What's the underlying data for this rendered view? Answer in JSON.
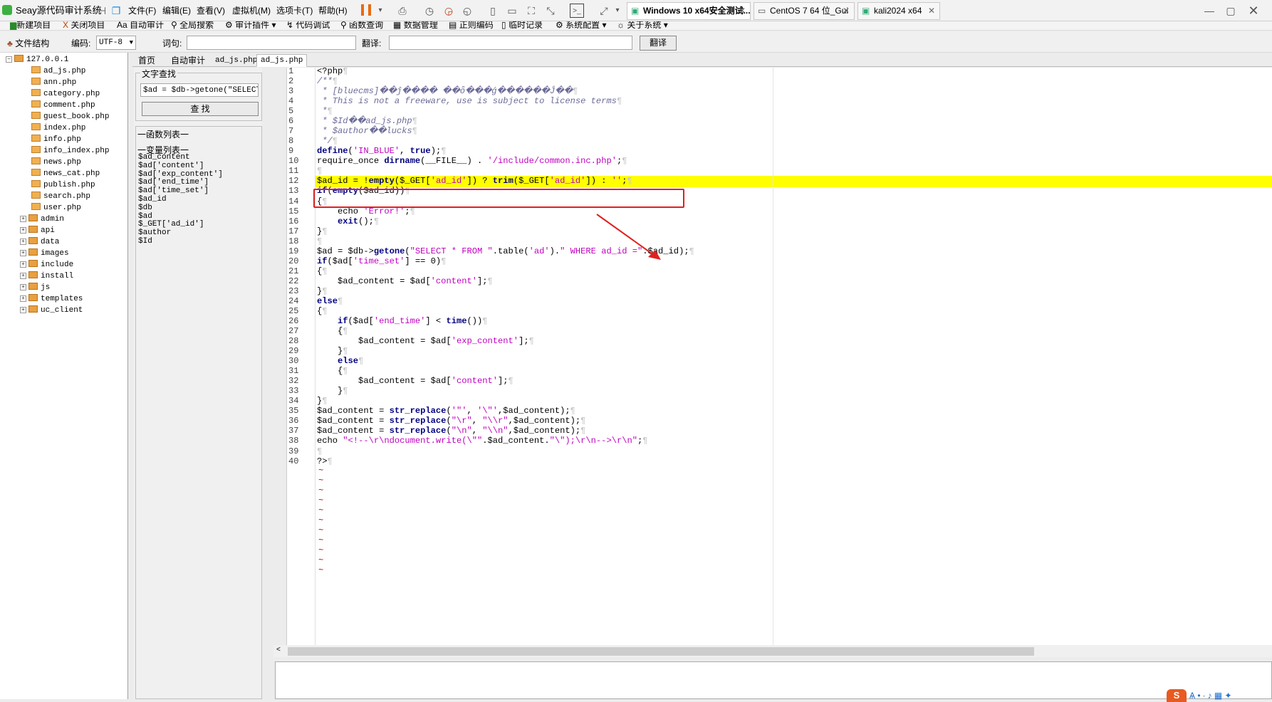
{
  "app": {
    "title": "Seay源代码审计系统"
  },
  "vmware": {
    "menus": [
      "文件(F)",
      "编辑(E)",
      "查看(V)",
      "虚拟机(M)",
      "选项卡(T)",
      "帮助(H)"
    ],
    "tabs": [
      {
        "label": "Windows 10 x64安全测试..."
      },
      {
        "label": "CentOS 7 64 位_Gui"
      },
      {
        "label": "kali2024 x64"
      }
    ]
  },
  "toolbar": {
    "items": [
      "新建项目",
      "关闭项目",
      "自动审计",
      "全局搜索",
      "审计插件",
      "代码调试",
      "函数查询",
      "数据管理",
      "正则编码",
      "临时记录",
      "系统配置",
      "关于系统"
    ]
  },
  "row2": {
    "file_structure": "文件结构",
    "encoding_label": "编码:",
    "encoding_value": "UTF-8",
    "word_label": "词句:",
    "translate_label": "翻译:",
    "translate_button": "翻译"
  },
  "tree": {
    "root": "127.0.0.1",
    "files": [
      "ad_js.php",
      "ann.php",
      "category.php",
      "comment.php",
      "guest_book.php",
      "index.php",
      "info.php",
      "info_index.php",
      "news.php",
      "news_cat.php",
      "publish.php",
      "search.php",
      "user.php"
    ],
    "folders": [
      "admin",
      "api",
      "data",
      "images",
      "include",
      "install",
      "js",
      "templates",
      "uc_client"
    ]
  },
  "tabs": [
    "首页",
    "自动审计",
    "ad_js.php",
    "ad_js.php"
  ],
  "search": {
    "group_title": "文字查找",
    "input_value": "$ad = $db->getone(\"SELECT * ",
    "button": "查 找"
  },
  "lists": {
    "functions_title": "一函数列表一",
    "variables_title": "一变量列表一",
    "variables": [
      "$ad_content",
      "$ad['content']",
      "$ad['exp_content']",
      "$ad['end_time']",
      "$ad['time_set']",
      "$ad_id",
      "$db",
      "$ad",
      "$_GET['ad_id']",
      "$author",
      "$Id"
    ]
  },
  "colors": {
    "highlight": "#ffff00",
    "annotation": "#e02020",
    "selection": "#1e64c8"
  }
}
